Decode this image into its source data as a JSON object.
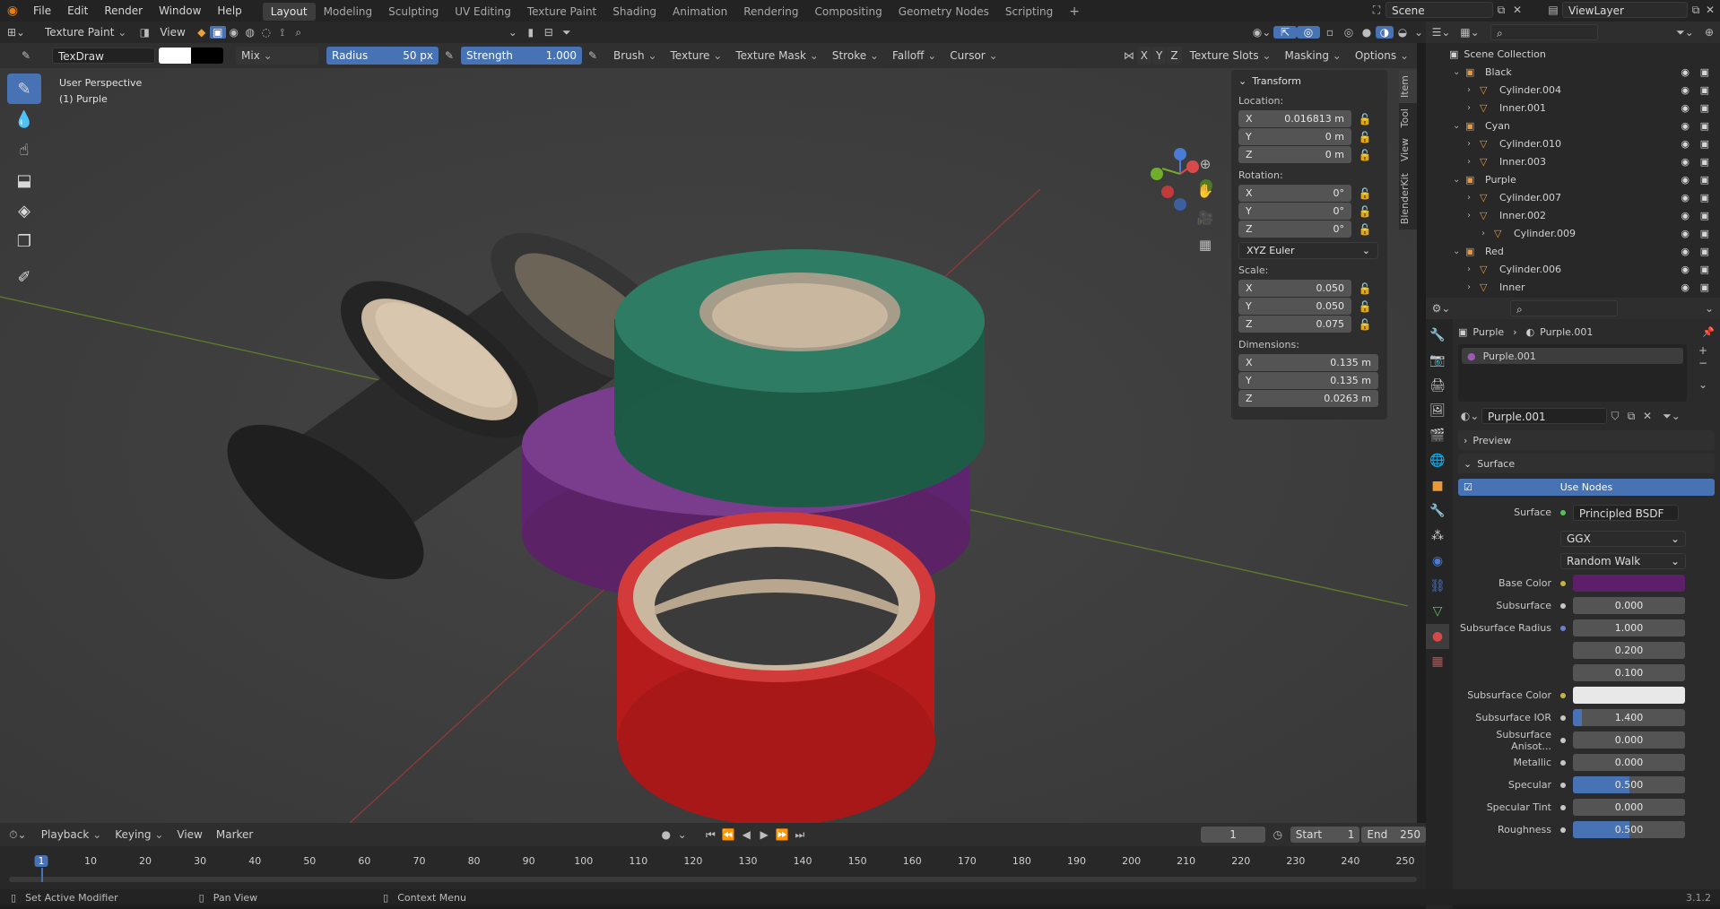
{
  "menus": [
    "File",
    "Edit",
    "Render",
    "Window",
    "Help"
  ],
  "workspaces": [
    "Layout",
    "Modeling",
    "Sculpting",
    "UV Editing",
    "Texture Paint",
    "Shading",
    "Animation",
    "Rendering",
    "Compositing",
    "Geometry Nodes",
    "Scripting"
  ],
  "scene": "Scene",
  "view_layer": "ViewLayer",
  "header": {
    "mode": "Texture Paint",
    "view": "View",
    "brush_name": "TexDraw",
    "blend": "Mix",
    "radius_label": "Radius",
    "radius_value": "50 px",
    "strength_label": "Strength",
    "strength_value": "1.000",
    "brush": "Brush",
    "texture": "Texture",
    "texture_mask": "Texture Mask",
    "stroke": "Stroke",
    "falloff": "Falloff",
    "cursor": "Cursor",
    "x": "X",
    "y": "Y",
    "z": "Z",
    "texture_slots": "Texture Slots",
    "masking": "Masking",
    "options": "Options"
  },
  "viewport": {
    "perspective": "User Perspective",
    "object": "(1) Purple",
    "gizmo_labels": [
      "X",
      "Y",
      "Z"
    ]
  },
  "npanel": {
    "title": "Transform",
    "location_label": "Location:",
    "location": {
      "x": "0.016813 m",
      "y": "0 m",
      "z": "0 m"
    },
    "rotation_label": "Rotation:",
    "rotation": {
      "x": "0°",
      "y": "0°",
      "z": "0°"
    },
    "rotation_mode": "XYZ Euler",
    "scale_label": "Scale:",
    "scale": {
      "x": "0.050",
      "y": "0.050",
      "z": "0.075"
    },
    "dimensions_label": "Dimensions:",
    "dimensions": {
      "x": "0.135 m",
      "y": "0.135 m",
      "z": "0.0263 m"
    },
    "tabs": [
      "Item",
      "Tool",
      "View",
      "BlenderKit"
    ]
  },
  "outliner": {
    "root": "Scene Collection",
    "rows": [
      {
        "label": "Black",
        "depth": 1,
        "kind": "collection"
      },
      {
        "label": "Cylinder.004",
        "depth": 2,
        "kind": "mesh"
      },
      {
        "label": "Inner.001",
        "depth": 2,
        "kind": "mesh"
      },
      {
        "label": "Cyan",
        "depth": 1,
        "kind": "collection"
      },
      {
        "label": "Cylinder.010",
        "depth": 2,
        "kind": "mesh"
      },
      {
        "label": "Inner.003",
        "depth": 2,
        "kind": "mesh"
      },
      {
        "label": "Purple",
        "depth": 1,
        "kind": "collection"
      },
      {
        "label": "Cylinder.007",
        "depth": 2,
        "kind": "mesh"
      },
      {
        "label": "Inner.002",
        "depth": 2,
        "kind": "mesh"
      },
      {
        "label": "Cylinder.009",
        "depth": 3,
        "kind": "mesh"
      },
      {
        "label": "Red",
        "depth": 1,
        "kind": "collection"
      },
      {
        "label": "Cylinder.006",
        "depth": 2,
        "kind": "mesh"
      },
      {
        "label": "Inner",
        "depth": 2,
        "kind": "mesh"
      }
    ]
  },
  "properties": {
    "breadcrumb_object": "Purple",
    "breadcrumb_material": "Purple.001",
    "slot": "Purple.001",
    "material_name": "Purple.001",
    "preview": "Preview",
    "surface_panel": "Surface",
    "use_nodes": "Use Nodes",
    "surface_label": "Surface",
    "surface_shader": "Principled BSDF",
    "distribution": "GGX",
    "subsurface_method": "Random Walk",
    "base_color_label": "Base Color",
    "base_color": "#5e1f6a",
    "fields": [
      {
        "label": "Subsurface",
        "value": "0.000",
        "fill": 0
      },
      {
        "label": "Subsurface Radius",
        "value": "1.000",
        "fill": 0
      },
      {
        "label": "",
        "value": "0.200",
        "fill": 0
      },
      {
        "label": "",
        "value": "0.100",
        "fill": 0
      }
    ],
    "subsurface_color_label": "Subsurface Color",
    "subsurface_color": "#e8e8e8",
    "fields2": [
      {
        "label": "Subsurface IOR",
        "value": "1.400",
        "fill": 0.08
      },
      {
        "label": "Subsurface Anisot...",
        "value": "0.000",
        "fill": 0
      },
      {
        "label": "Metallic",
        "value": "0.000",
        "fill": 0
      },
      {
        "label": "Specular",
        "value": "0.500",
        "fill": 0.5
      },
      {
        "label": "Specular Tint",
        "value": "0.000",
        "fill": 0
      },
      {
        "label": "Roughness",
        "value": "0.500",
        "fill": 0.5
      }
    ]
  },
  "timeline": {
    "playback": "Playback",
    "keying": "Keying",
    "view": "View",
    "marker": "Marker",
    "current_frame": "1",
    "start_label": "Start",
    "start": "1",
    "end_label": "End",
    "end": "250",
    "ruler": [
      "1",
      "10",
      "20",
      "30",
      "40",
      "50",
      "60",
      "70",
      "80",
      "90",
      "100",
      "110",
      "120",
      "130",
      "140",
      "150",
      "160",
      "170",
      "180",
      "190",
      "200",
      "210",
      "220",
      "230",
      "240",
      "250"
    ]
  },
  "status": {
    "left": "Set Active Modifier",
    "mid": "Pan View",
    "right": "Context Menu",
    "version": "3.1.2"
  },
  "colors": {
    "accent": "#4772b3",
    "tape_black": "#2b2b2b",
    "tape_green": "#2a7a5e",
    "tape_purple": "#6b2a7c",
    "tape_red": "#c41d1d",
    "tape_inner": "#c9b7a0"
  }
}
